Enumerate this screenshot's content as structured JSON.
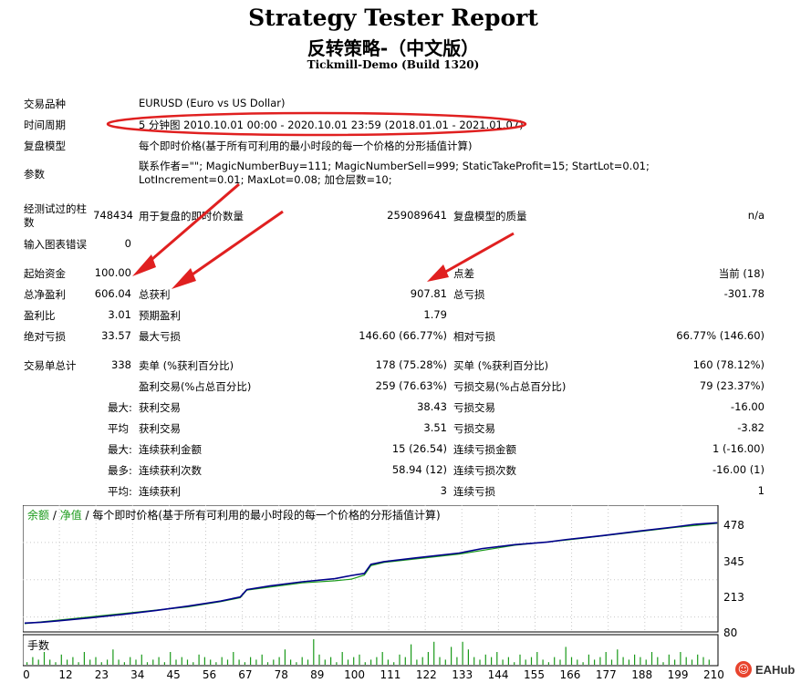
{
  "header": {
    "title": "Strategy Tester Report",
    "subtitle": "反转策略-（中文版）",
    "server": "Tickmill-Demo (Build 1320)"
  },
  "info": {
    "symbol_label": "交易品种",
    "symbol_value": "EURUSD (Euro vs US Dollar)",
    "period_label": "时间周期",
    "period_value": "5 分钟图 2010.10.01 00:00 - 2020.10.01 23:59 (2018.01.01 - 2021.01.07)",
    "model_label": "复盘模型",
    "model_value": "每个即时价格(基于所有可利用的最小时段的每一个价格的分形插值计算)",
    "params_label": "参数",
    "params_value": "联系作者=\"\"; MagicNumberBuy=111; MagicNumberSell=999; StaticTakeProfit=15; StartLot=0.01; LotIncrement=0.01; MaxLot=0.08; 加仓层数=10;"
  },
  "bars_row": {
    "bars_label": "经测试过的柱数",
    "bars_value": "748434",
    "ticks_label": "用于复盘的即时价数量",
    "ticks_value": "259089641",
    "quality_label": "复盘模型的质量",
    "quality_value": "n/a"
  },
  "errors_row": {
    "label": "输入图表错误",
    "value": "0"
  },
  "stats": [
    {
      "l1": "起始资金",
      "v1": "100.00",
      "l2": "",
      "v2": "",
      "l3": "点差",
      "v3": "当前 (18)"
    },
    {
      "l1": "总净盈利",
      "v1": "606.04",
      "l2": "总获利",
      "v2": "907.81",
      "l3": "总亏损",
      "v3": "-301.78"
    },
    {
      "l1": "盈利比",
      "v1": "3.01",
      "l2": "预期盈利",
      "v2": "1.79",
      "l3": "",
      "v3": ""
    },
    {
      "l1": "绝对亏损",
      "v1": "33.57",
      "l2": "最大亏损",
      "v2": "146.60 (66.77%)",
      "l3": "相对亏损",
      "v3": "66.77% (146.60)"
    }
  ],
  "trades": [
    {
      "l1": "交易单总计",
      "v1": "338",
      "l2": "卖单 (%获利百分比)",
      "v2": "178 (75.28%)",
      "l3": "买单 (%获利百分比)",
      "v3": "160 (78.12%)"
    },
    {
      "l1": "",
      "v1": "",
      "l2": "盈利交易(%占总百分比)",
      "v2": "259 (76.63%)",
      "l3": "亏损交易(%占总百分比)",
      "v3": "79 (23.37%)"
    },
    {
      "l1": "最大:",
      "v1": "",
      "l2": "获利交易",
      "v2": "38.43",
      "l3": "亏损交易",
      "v3": "-16.00"
    },
    {
      "l1": "平均",
      "v1": "",
      "l2": "获利交易",
      "v2": "3.51",
      "l3": "亏损交易",
      "v3": "-3.82"
    },
    {
      "l1": "最大:",
      "v1": "",
      "l2": "连续获利金额",
      "v2": "15 (26.54)",
      "l3": "连续亏损金额",
      "v3": "1 (-16.00)"
    },
    {
      "l1": "最多:",
      "v1": "",
      "l2": "连续获利次数",
      "v2": "58.94 (12)",
      "l3": "连续亏损次数",
      "v3": "-16.00 (1)"
    },
    {
      "l1": "平均:",
      "v1": "",
      "l2": "连续获利",
      "v2": "3",
      "l3": "连续亏损",
      "v3": "1"
    }
  ],
  "chart_legend": {
    "balance": "余额",
    "sep1": " / ",
    "equity": "净值",
    "sep2": " / ",
    "model": "每个即时价格(基于所有可利用的最小时段的每一个价格的分形插值计算)"
  },
  "volume_label": "手数",
  "chart_data": {
    "type": "line",
    "yticks": [
      "478",
      "345",
      "213",
      "80"
    ],
    "ylim": [
      80,
      478
    ],
    "xticks": [
      "0",
      "12",
      "23",
      "34",
      "45",
      "56",
      "67",
      "78",
      "89",
      "100",
      "111",
      "122",
      "133",
      "144",
      "155",
      "166",
      "177",
      "188",
      "199",
      "210"
    ],
    "xlim": [
      0,
      210
    ],
    "series": [
      {
        "name": "余额",
        "x": [
          0,
          5,
          10,
          20,
          30,
          40,
          50,
          60,
          66,
          68,
          75,
          85,
          95,
          100,
          104,
          106,
          110,
          120,
          133,
          140,
          150,
          160,
          166,
          177,
          188,
          199,
          205,
          212
        ],
        "y": [
          100,
          103,
          108,
          120,
          133,
          148,
          165,
          184,
          200,
          228,
          242,
          258,
          270,
          282,
          290,
          325,
          335,
          350,
          368,
          385,
          400,
          410,
          420,
          435,
          452,
          468,
          478,
          484
        ],
        "color": "#00008b"
      },
      {
        "name": "净值",
        "x": [
          0,
          50,
          60,
          66,
          68,
          85,
          95,
          100,
          104,
          106,
          110,
          133,
          150,
          166,
          188,
          199,
          212
        ],
        "y": [
          98,
          162,
          182,
          197,
          226,
          254,
          262,
          268,
          284,
          320,
          332,
          364,
          398,
          418,
          450,
          466,
          482
        ],
        "color": "#1a9a1a"
      }
    ],
    "volume_bars": [
      0.1,
      0.3,
      0.2,
      0.5,
      0.2,
      0.1,
      0.4,
      0.2,
      0.3,
      0.1,
      0.5,
      0.2,
      0.3,
      0.1,
      0.2,
      0.6,
      0.2,
      0.1,
      0.3,
      0.2,
      0.4,
      0.1,
      0.2,
      0.3,
      0.1,
      0.5,
      0.2,
      0.3,
      0.2,
      0.1,
      0.4,
      0.3,
      0.2,
      0.1,
      0.3,
      0.2,
      0.5,
      0.2,
      0.1,
      0.3,
      0.2,
      0.4,
      0.1,
      0.2,
      0.3,
      0.6,
      0.2,
      0.1,
      0.3,
      0.2,
      1.0,
      0.4,
      0.2,
      0.3,
      0.1,
      0.5,
      0.2,
      0.3,
      0.4,
      0.1,
      0.2,
      0.3,
      0.5,
      0.2,
      0.1,
      0.4,
      0.3,
      0.8,
      0.2,
      0.3,
      0.5,
      0.9,
      0.3,
      0.2,
      0.7,
      0.3,
      0.9,
      0.6,
      0.3,
      0.2,
      0.4,
      0.3,
      0.5,
      0.2,
      0.3,
      0.1,
      0.4,
      0.2,
      0.3,
      0.5,
      0.2,
      0.1,
      0.3,
      0.2,
      0.7,
      0.3,
      0.2,
      0.1,
      0.4,
      0.2,
      0.3,
      0.5,
      0.2,
      0.6,
      0.3,
      0.2,
      0.4,
      0.3,
      0.2,
      0.5,
      0.3,
      0.1,
      0.4,
      0.2,
      0.5,
      0.3,
      0.2,
      0.4,
      0.3,
      0.2
    ]
  },
  "colors": {
    "balance_line": "#00008b",
    "equity_line": "#1a9a1a",
    "annotation_red": "#e02020",
    "volume_bar": "#1a9a1a"
  },
  "watermark": {
    "icon": "eahub-logo-icon",
    "text": "EAHub"
  }
}
